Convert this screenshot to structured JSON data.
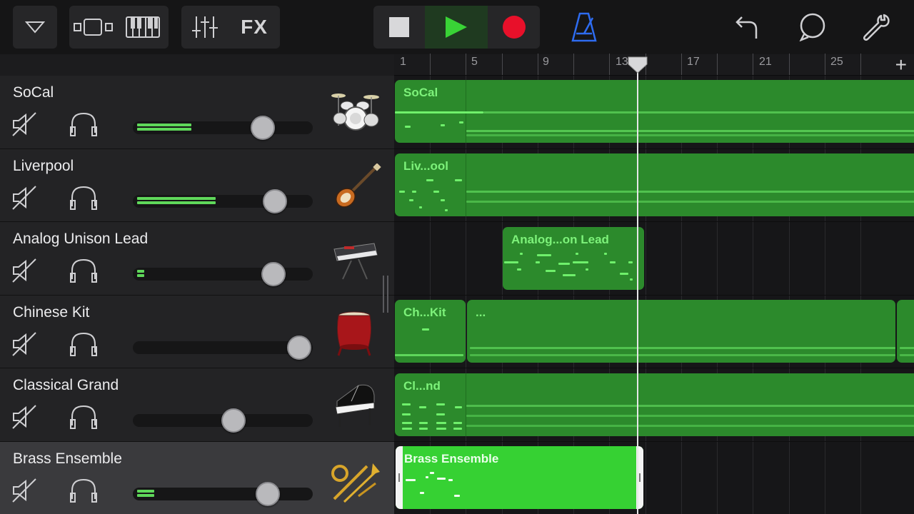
{
  "toolbar": {
    "fx_label": "FX",
    "icons": [
      "track-menu-icon",
      "track-view-icon",
      "keyboard-icon",
      "mixer-icon",
      "stop-icon",
      "play-icon",
      "record-icon",
      "metronome-icon",
      "undo-icon",
      "loop-browser-icon",
      "settings-icon"
    ]
  },
  "ruler": {
    "bars": [
      "1",
      "5",
      "9",
      "13",
      "17",
      "21",
      "25"
    ],
    "add_label": "+"
  },
  "colors": {
    "accent_green": "#36d133",
    "region_green": "#2c8a2c",
    "record_red": "#e8102a",
    "metronome_blue": "#2e6cf0"
  },
  "tracks": [
    {
      "name": "SoCal",
      "volume": 0.72,
      "meter": 0.3,
      "instrument_icon": "drum-kit-icon"
    },
    {
      "name": "Liverpool",
      "volume": 0.78,
      "meter": 0.45,
      "instrument_icon": "bass-guitar-icon"
    },
    {
      "name": "Analog Unison Lead",
      "volume": 0.78,
      "meter": 0.04,
      "instrument_icon": "synth-keyboard-icon"
    },
    {
      "name": "Chinese Kit",
      "volume": 0.96,
      "meter": 0.0,
      "instrument_icon": "chinese-drum-icon"
    },
    {
      "name": "Classical Grand",
      "volume": 0.56,
      "meter": 0.0,
      "instrument_icon": "grand-piano-icon"
    },
    {
      "name": "Brass Ensemble",
      "volume": 0.76,
      "meter": 0.08,
      "instrument_icon": "brass-icon"
    }
  ],
  "regions": [
    {
      "title": "SoCal",
      "lane": 0
    },
    {
      "title": "Liv...ool",
      "lane": 1
    },
    {
      "title": "Analog...on Lead",
      "lane": 2
    },
    {
      "title": "Ch...Kit",
      "lane": 3
    },
    {
      "title": "...",
      "lane": 3
    },
    {
      "title": "Cl...nd",
      "lane": 4
    },
    {
      "title": "Brass Ensemble",
      "lane": 5
    }
  ]
}
